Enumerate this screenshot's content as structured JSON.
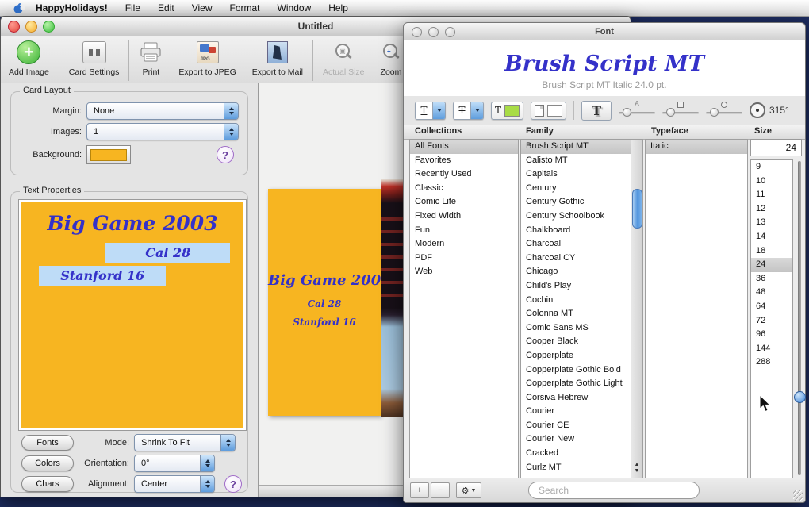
{
  "menu_bar": {
    "app_name": "HappyHolidays!",
    "items": [
      "File",
      "Edit",
      "View",
      "Format",
      "Window",
      "Help"
    ]
  },
  "main_window": {
    "title": "Untitled",
    "toolbar": {
      "add_image": "Add Image",
      "card_settings": "Card Settings",
      "print": "Print",
      "export_jpeg": "Export to JPEG",
      "export_mail": "Export to Mail",
      "actual_size": "Actual Size",
      "zoom": "Zoom"
    },
    "card_layout": {
      "section_title": "Card Layout",
      "margin_label": "Margin:",
      "margin_value": "None",
      "images_label": "Images:",
      "images_value": "1",
      "background_label": "Background:",
      "background_color": "#f7b521",
      "help_label": "?"
    },
    "text_properties": {
      "section_title": "Text Properties",
      "fonts_button": "Fonts",
      "colors_button": "Colors",
      "chars_button": "Chars",
      "mode_label": "Mode:",
      "mode_value": "Shrink To Fit",
      "orientation_label": "Orientation:",
      "orientation_value": "0°",
      "alignment_label": "Alignment:",
      "alignment_value": "Center",
      "help_label": "?"
    },
    "card_text": {
      "line1": "Big Game 2003",
      "line2": "Cal 28",
      "line3": "Stanford 16"
    }
  },
  "font_panel": {
    "title": "Font",
    "preview_text": "Brush Script MT",
    "preview_subtitle": "Brush Script MT Italic 24.0 pt.",
    "shadow_angle": "315°",
    "headers": {
      "collections": "Collections",
      "family": "Family",
      "typeface": "Typeface",
      "size": "Size"
    },
    "collections": [
      "All Fonts",
      "Favorites",
      "Recently Used",
      "Classic",
      "Comic Life",
      "Fixed Width",
      "Fun",
      "Modern",
      "PDF",
      "Web"
    ],
    "collections_selected": "All Fonts",
    "families": [
      "Brush Script MT",
      "Calisto MT",
      "Capitals",
      "Century",
      "Century Gothic",
      "Century Schoolbook",
      "Chalkboard",
      "Charcoal",
      "Charcoal CY",
      "Chicago",
      "Child's Play",
      "Cochin",
      "Colonna MT",
      "Comic Sans MS",
      "Cooper Black",
      "Copperplate",
      "Copperplate Gothic Bold",
      "Copperplate Gothic Light",
      "Corsiva Hebrew",
      "Courier",
      "Courier CE",
      "Courier New",
      "Cracked",
      "Curlz MT"
    ],
    "families_selected": "Brush Script MT",
    "typefaces": [
      "Italic"
    ],
    "typeface_selected": "Italic",
    "size_field_value": "24",
    "sizes": [
      "9",
      "10",
      "11",
      "12",
      "13",
      "14",
      "18",
      "24",
      "36",
      "48",
      "64",
      "72",
      "96",
      "144",
      "288"
    ],
    "size_selected": "24",
    "effects": {
      "underline_glyph": "T",
      "strike_glyph": "T",
      "text_color_glyph": "T",
      "shadow_glyph": "T",
      "text_color": "#a8dc46",
      "document_color": "#ffffff"
    },
    "bottom_bar": {
      "add_label": "+",
      "remove_label": "−",
      "gear_label": "⚙",
      "search_placeholder": "Search"
    }
  }
}
